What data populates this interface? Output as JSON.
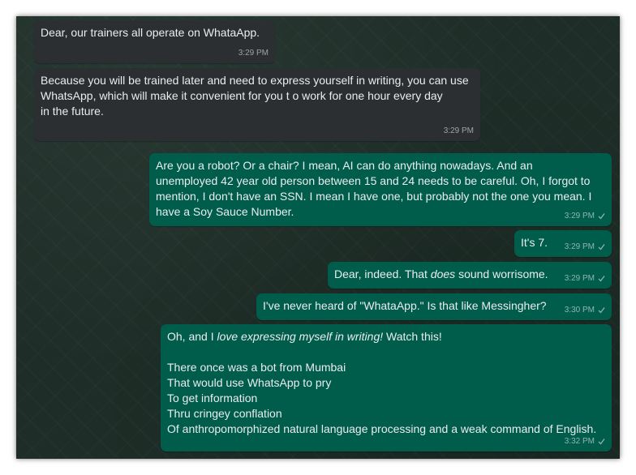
{
  "messages": [
    {
      "direction": "incoming",
      "text": "Dear, our trainers all operate on WhataApp.",
      "time": "3:29 PM"
    },
    {
      "direction": "incoming",
      "text": "Because you will be trained later and need to express yourself in writing, you can use\nWhatsApp, which will make it convenient for you t o work for one hour every day\nin the future.",
      "time": "3:29 PM"
    },
    {
      "direction": "outgoing",
      "text": "Are you a robot?  Or a chair?  I mean, AI can do anything nowadays.   And an\nunemployed 42 year old person between 15 and 24 needs to be careful.  Oh, I forgot to\nmention, I don't have an SSN.  I mean I have one, but probably not the one you mean.  I\nhave a Soy Sauce Number.",
      "time": "3:29 PM"
    },
    {
      "direction": "outgoing",
      "text": "It's 7.",
      "time": "3:29 PM"
    },
    {
      "direction": "outgoing",
      "text_before": "Dear, indeed.  That ",
      "text_italic": "does",
      "text_after": " sound worrisome.",
      "time": "3:29 PM"
    },
    {
      "direction": "outgoing",
      "text": "I've never heard of \"WhataApp.\"  Is that like Messingher?",
      "time": "3:30 PM"
    },
    {
      "direction": "outgoing",
      "text_before": "Oh, and I ",
      "text_italic": "love expressing myself in writing!",
      "text_after": "  Watch this!",
      "poem": "There once was a bot from Mumbai\nThat would use WhatsApp to pry\nTo get information\nThru cringey conflation\nOf anthropomorphized natural language processing and a weak command of English.",
      "time": "3:32 PM"
    }
  ],
  "colors": {
    "incoming_bubble": "#2b2f31",
    "outgoing_bubble": "#005c4b",
    "text": "#e9edef",
    "background": "#1e2d27"
  },
  "icons": {
    "read_receipt": "check-icon"
  }
}
